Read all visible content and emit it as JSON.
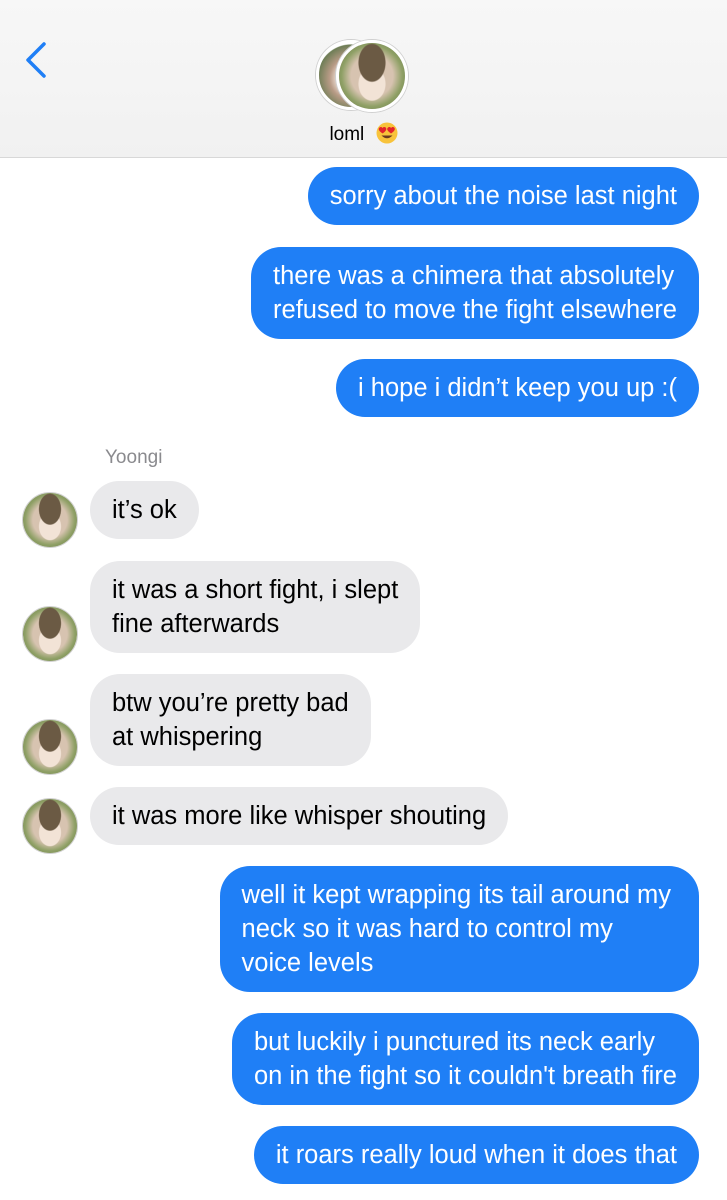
{
  "header": {
    "back_icon": "chevron-left-icon",
    "contact_name": "loml",
    "contact_emoji": "😍",
    "avatar_icon": "contact-photo"
  },
  "sender_label": "Yoongi",
  "colors": {
    "outgoing_bubble": "#1f7ff6",
    "incoming_bubble": "#e9e9eb",
    "back_chevron": "#1f7ff6"
  },
  "messages": [
    {
      "direction": "out",
      "lines": [
        "sorry about the noise last night"
      ]
    },
    {
      "direction": "out",
      "lines": [
        "there was a chimera that absolutely",
        "refused to move the fight elsewhere"
      ]
    },
    {
      "direction": "out",
      "lines": [
        "i hope i didn’t keep you up :("
      ]
    },
    {
      "direction": "in",
      "lines": [
        "it’s ok"
      ]
    },
    {
      "direction": "in",
      "lines": [
        "it was a short fight, i slept",
        "fine afterwards"
      ]
    },
    {
      "direction": "in",
      "lines": [
        "btw you’re pretty bad",
        "at whispering"
      ]
    },
    {
      "direction": "in",
      "lines": [
        "it was more like whisper shouting"
      ]
    },
    {
      "direction": "out",
      "lines": [
        "well it kept wrapping its tail around my",
        "neck so it was hard to control my",
        "voice levels"
      ]
    },
    {
      "direction": "out",
      "lines": [
        "but luckily i punctured its neck early",
        "on in the fight so it couldn't breath fire"
      ]
    },
    {
      "direction": "out",
      "lines": [
        "it roars really loud when it does that"
      ]
    }
  ]
}
